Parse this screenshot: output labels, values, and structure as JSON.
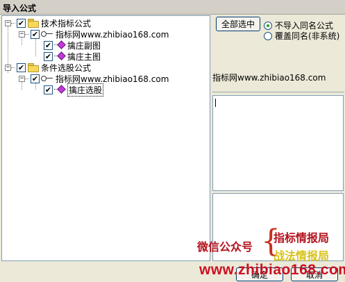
{
  "window": {
    "title": "导入公式"
  },
  "tree": {
    "items": [
      {
        "label": "技术指标公式",
        "expander": "−",
        "checked": "✔"
      },
      {
        "label": "指标网www.zhibiao168.com",
        "expander": "−",
        "checked": "✔"
      },
      {
        "label": "擒庄副图",
        "checked": "✔"
      },
      {
        "label": "擒庄主图",
        "checked": "✔"
      },
      {
        "label": "条件选股公式",
        "expander": "−",
        "checked": "✔"
      },
      {
        "label": "指标网www.zhibiao168.com",
        "expander": "−",
        "checked": "✔"
      },
      {
        "label": "擒庄选股",
        "checked": "✔"
      }
    ]
  },
  "actions": {
    "select_all_label": "全部选中",
    "ok_label": "确定",
    "cancel_label": "取消"
  },
  "options": {
    "no_import_same_name": "不导入同名公式",
    "overwrite_same_name": "覆盖同名(非系统)",
    "selected": "不导入同名公式"
  },
  "info": {
    "source_label": "指标网www.zhibiao168.com"
  },
  "watermark": {
    "wechat": "微信公众号",
    "line1": "指标情报局",
    "line2": "战法情报局",
    "url": "www.zhibiao168.com",
    "brace": "{"
  },
  "colors": {
    "accent_red": "#b3121d",
    "accent_yellow": "#d7c21a",
    "radio_dot": "#21a121"
  }
}
